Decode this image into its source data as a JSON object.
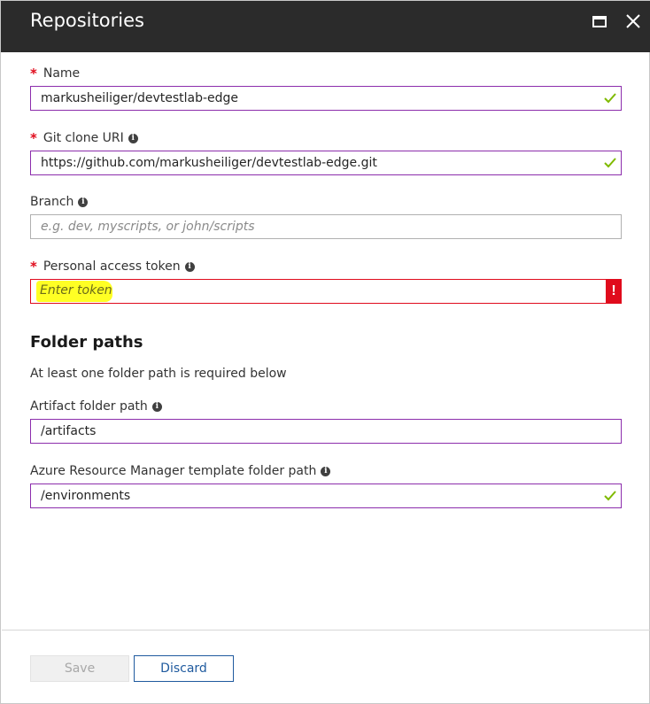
{
  "window": {
    "title": "Repositories"
  },
  "form": {
    "name": {
      "label": "Name",
      "required_mark": "*",
      "value": "markusheiliger/devtestlab-edge"
    },
    "git_clone_uri": {
      "label": "Git clone URI",
      "required_mark": "*",
      "value": "https://github.com/markusheiliger/devtestlab-edge.git"
    },
    "branch": {
      "label": "Branch",
      "placeholder": "e.g. dev, myscripts, or john/scripts"
    },
    "token": {
      "label": "Personal access token",
      "required_mark": "*",
      "placeholder": "Enter token",
      "error_mark": "!"
    }
  },
  "folder_paths": {
    "title": "Folder paths",
    "description": "At least one folder path is required below",
    "artifact": {
      "label": "Artifact folder path",
      "value": "/artifacts"
    },
    "arm_template": {
      "label": "Azure Resource Manager template folder path",
      "value": "/environments"
    }
  },
  "footer": {
    "save_label": "Save",
    "discard_label": "Discard"
  },
  "colors": {
    "titlebar": "#2b2b2b",
    "focus_border": "#8c2dac",
    "error": "#e00b1c",
    "valid_check": "#7fba00",
    "highlight": "#ffff24",
    "discard_accent": "#1f5a9e"
  },
  "icons": [
    "maximize-icon",
    "close-icon",
    "info-icon",
    "checkmark-icon",
    "error-icon"
  ]
}
